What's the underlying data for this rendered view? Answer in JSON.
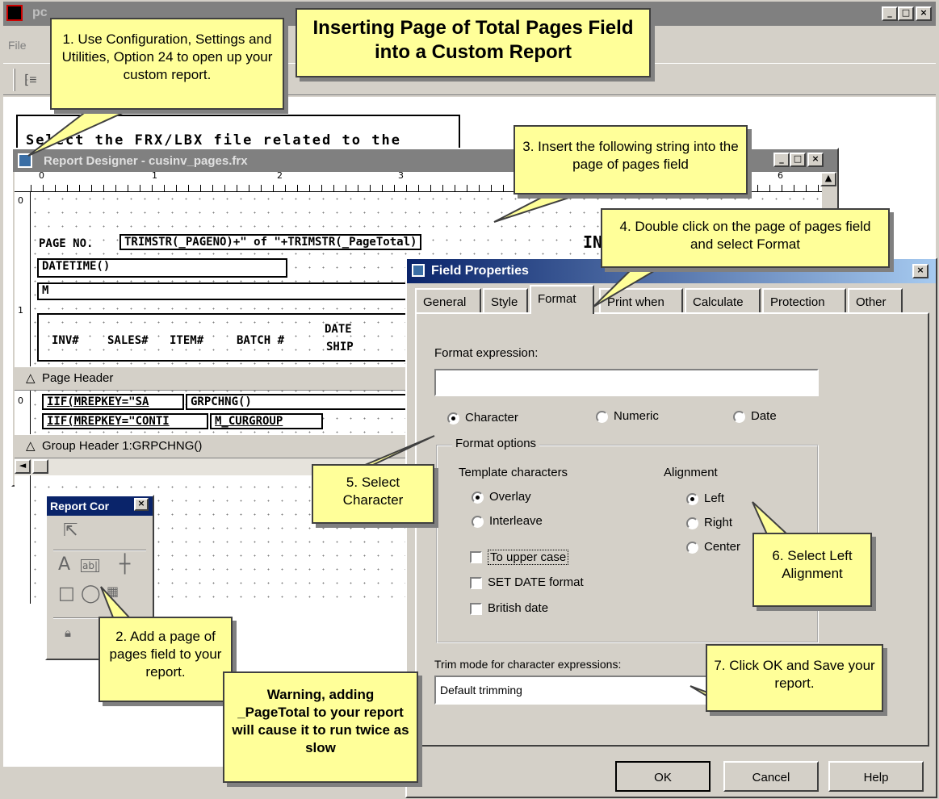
{
  "main": {
    "title": "pc",
    "menu": [
      "File"
    ]
  },
  "workspace": {
    "prompt_text": "Select the FRX/LBX file related to the"
  },
  "report_designer": {
    "title": "Report Designer - cusinv_pages.frx",
    "ruler_numbers": [
      "0",
      "1",
      "2",
      "3",
      "6"
    ],
    "vruler_numbers": [
      "0",
      "1",
      "0"
    ],
    "fields": {
      "page_no_label": "PAGE NO.",
      "page_expr": "TRIMSTR(_PAGENO)+\" of \"+TRIMSTR(_PageTotal)",
      "title_partial": "IN",
      "datetime": "DATETIME()",
      "m_field": "M",
      "col_inv": "INV#",
      "col_sales": "SALES#",
      "col_item": "ITEM#",
      "col_batch": "BATCH #",
      "col_date": "DATE",
      "col_ship": "SHIP",
      "iif_sa": "IIF(MREPKEY=\"SA",
      "grpchng": "GRPCHNG()",
      "iif_cont": "IIF(MREPKEY=\"CONTI",
      "m_curgroup": "M_CURGROUP"
    },
    "bands": {
      "page_header": "Page Header",
      "group_header": "Group Header 1:GRPCHNG()"
    }
  },
  "report_controls": {
    "title": "Report Cor"
  },
  "field_properties": {
    "title": "Field Properties",
    "tabs": [
      "General",
      "Style",
      "Format",
      "Print when",
      "Calculate",
      "Protection",
      "Other"
    ],
    "active_tab": "Format",
    "format_expression_label": "Format expression:",
    "format_expression_value": "",
    "types": {
      "character": "Character",
      "numeric": "Numeric",
      "date": "Date",
      "selected": "Character"
    },
    "format_options_label": "Format options",
    "template_label": "Template characters",
    "overlay": "Overlay",
    "interleave": "Interleave",
    "alignment_label": "Alignment",
    "left": "Left",
    "right": "Right",
    "center": "Center",
    "to_upper": "To upper case",
    "set_date": "SET DATE format",
    "british_date": "British date",
    "trim_label": "Trim mode for character expressions:",
    "trim_value": "Default trimming",
    "ok": "OK",
    "cancel": "Cancel",
    "help": "Help"
  },
  "callouts": {
    "title": "Inserting Page of Total Pages Field into a Custom Report",
    "c1": "1. Use Configuration, Settings and Utilities, Option 24 to open up your custom report.",
    "c2": "2. Add a page of pages field to your report.",
    "c3": "3. Insert the following string into the page of pages field",
    "c4": "4. Double click on the page of pages field and select Format",
    "c5": "5. Select Character",
    "c6": "6. Select Left Alignment",
    "c7": "7. Click OK and Save your report.",
    "warning": "Warning, adding _PageTotal to your report will cause it to run twice as slow"
  },
  "colors": {
    "callout_bg": "#ffff99",
    "title_active": "#0a246a",
    "title_inactive": "#808080"
  }
}
